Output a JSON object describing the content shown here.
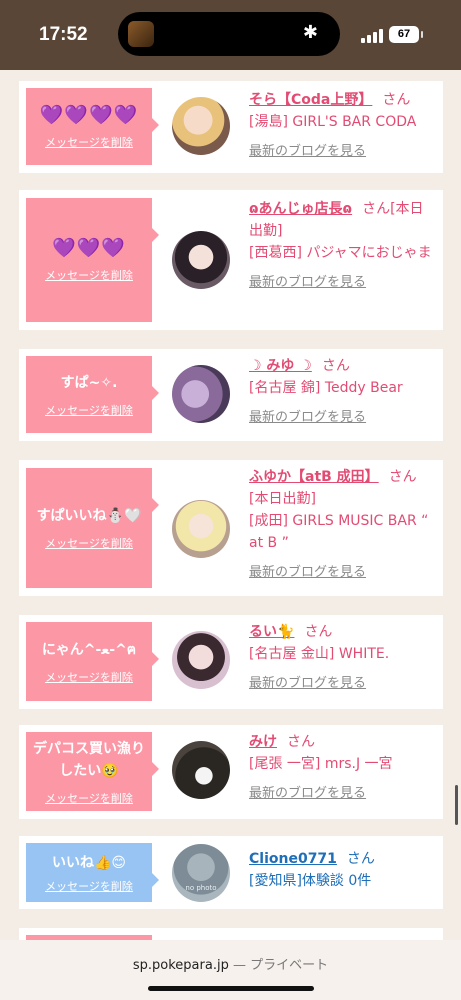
{
  "status_bar": {
    "time": "17:52",
    "battery": "67",
    "bluetooth_icon": "bluetooth-icon"
  },
  "messages": [
    {
      "message": "💜💜💜💜",
      "delete_label": "メッセージを削除",
      "name": "そら【Coda上野】",
      "honorific": "さん",
      "shop_lines": [
        "[湯島] GIRL'S BAR CODA"
      ],
      "blog_link": "最新のブログを見る"
    },
    {
      "message": "💜💜💜",
      "delete_label": "メッセージを削除",
      "name": "ɷあんじゅ店長ɷ",
      "honorific": "さん",
      "name_suffix": "[本日出勤]",
      "shop_lines": [
        "[西葛西] パジャマにおじゃま"
      ],
      "blog_link": "最新のブログを見る"
    },
    {
      "message": "すぱ~✧.",
      "delete_label": "メッセージを削除",
      "name": "☽ みゆ ☽",
      "honorific": "さん",
      "shop_lines": [
        "[名古屋 錦] Teddy Bear"
      ],
      "blog_link": "最新のブログを見る"
    },
    {
      "message": "すぱいいね⛄🤍",
      "delete_label": "メッセージを削除",
      "name": "ふゆか【atB 成田】",
      "honorific": "さん",
      "shop_lines": [
        "[本日出勤]",
        "[成田] GIRLS MUSIC BAR “ at B ”"
      ],
      "blog_link": "最新のブログを見る"
    },
    {
      "message": "にゃん^-ﻌ-^ฅ",
      "delete_label": "メッセージを削除",
      "name": "るい🐈",
      "honorific": "さん",
      "shop_lines": [
        "[名古屋 金山] WHITE."
      ],
      "blog_link": "最新のブログを見る"
    },
    {
      "message": "デパコス買い漁りしたい🥹",
      "delete_label": "メッセージを削除",
      "name": "みけ",
      "honorific": "さん",
      "shop_lines": [
        "[尾張 一宮] mrs.J 一宮"
      ],
      "blog_link": "最新のブログを見る"
    },
    {
      "message": "いいね👍😊",
      "delete_label": "メッセージを削除",
      "name": "Clione0771",
      "honorific": "さん",
      "shop_lines": [
        "[愛知県]体験談 0件"
      ],
      "avatar_text": "no photo"
    }
  ],
  "browser": {
    "domain": "sp.pokepara.jp",
    "separator": " — ",
    "mode": "プライベート"
  }
}
